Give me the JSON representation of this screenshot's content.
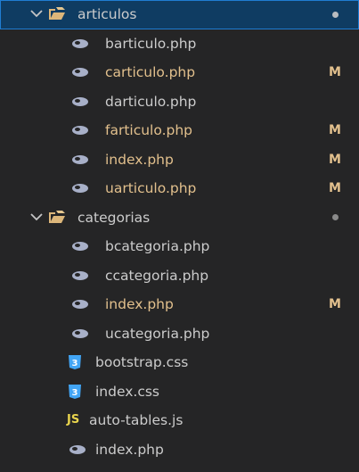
{
  "explorer": {
    "folders": [
      {
        "name": "articulos",
        "expanded": true,
        "selected": true,
        "status": "dot",
        "files": [
          {
            "name": "barticulo.php",
            "status": ""
          },
          {
            "name": "carticulo.php",
            "status": "M"
          },
          {
            "name": "darticulo.php",
            "status": ""
          },
          {
            "name": "farticulo.php",
            "status": "M"
          },
          {
            "name": "index.php",
            "status": "M"
          },
          {
            "name": "uarticulo.php",
            "status": "M"
          }
        ]
      },
      {
        "name": "categorias",
        "expanded": true,
        "selected": false,
        "status": "dot",
        "files": [
          {
            "name": "bcategoria.php",
            "status": ""
          },
          {
            "name": "ccategoria.php",
            "status": ""
          },
          {
            "name": "index.php",
            "status": "M"
          },
          {
            "name": "ucategoria.php",
            "status": ""
          }
        ]
      }
    ],
    "root_files": [
      {
        "name": "bootstrap.css",
        "type": "css",
        "status": ""
      },
      {
        "name": "index.css",
        "type": "css",
        "status": ""
      },
      {
        "name": "auto-tables.js",
        "type": "js",
        "status": "",
        "badge": "JS"
      },
      {
        "name": "index.php",
        "type": "php",
        "status": ""
      }
    ]
  },
  "icons": {
    "folder": "folder-open-icon",
    "php": "php-elephant-icon",
    "css": "css3-icon",
    "js": "js-icon",
    "chevron": "chevron-down-icon"
  },
  "colors": {
    "background": "#252526",
    "selected_bg": "#0f3c62",
    "selected_border": "#1f7dd2",
    "text": "#cccccc",
    "modified_text": "#e2c08d",
    "folder_icon": "#dcb67a",
    "php_icon": "#a8b0c8",
    "css_icon": "#42a5f5",
    "js_badge": "#e8d44d",
    "dot": "#8a8a8a"
  }
}
